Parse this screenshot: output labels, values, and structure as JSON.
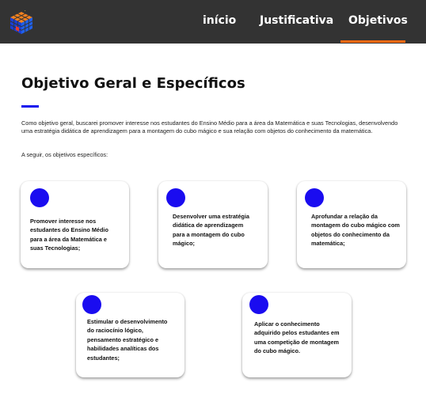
{
  "nav": {
    "logo_icon": "rubiks-cube-icon",
    "links": [
      {
        "label": "início"
      },
      {
        "label": "Justificativa"
      },
      {
        "label": "Objetivos"
      }
    ],
    "active_color": "#ff6a13"
  },
  "section": {
    "title": "Objetivo Geral e Específicos",
    "accent_color": "#1212ee",
    "intro": "Como objetivo geral, buscarei promover interesse nos estudantes do Ensino Médio para a área da Matemática e suas Tecnologias, desenvolvendo uma estratégia didática de aprendizagem para a montagem do cubo mágico e sua relação com objetos do conhecimento da matemática.",
    "subtitle": "A seguir, os objetivos específicos:"
  },
  "objectives": [
    {
      "text": "Promover interesse nos estudantes do Ensino Médio para a área da Matemática e suas Tecnologias;"
    },
    {
      "text": "Desenvolver uma estratégia didática de aprendizagem para a montagem do cubo mágico;"
    },
    {
      "text": "Aprofundar a relação da montagem do cubo mágico com objetos do conhecimento da matemática;"
    },
    {
      "text": "Estimular o desenvolvimento do raciocínio lógico, pensamento estratégico e habilidades analíticas dos estudantes;"
    },
    {
      "text": "Aplicar o conhecimento adquirido pelos estudantes em uma competição de montagem do cubo mágico."
    }
  ],
  "colors": {
    "navbar": "#333333",
    "card_dot": "#1a0cf0"
  }
}
